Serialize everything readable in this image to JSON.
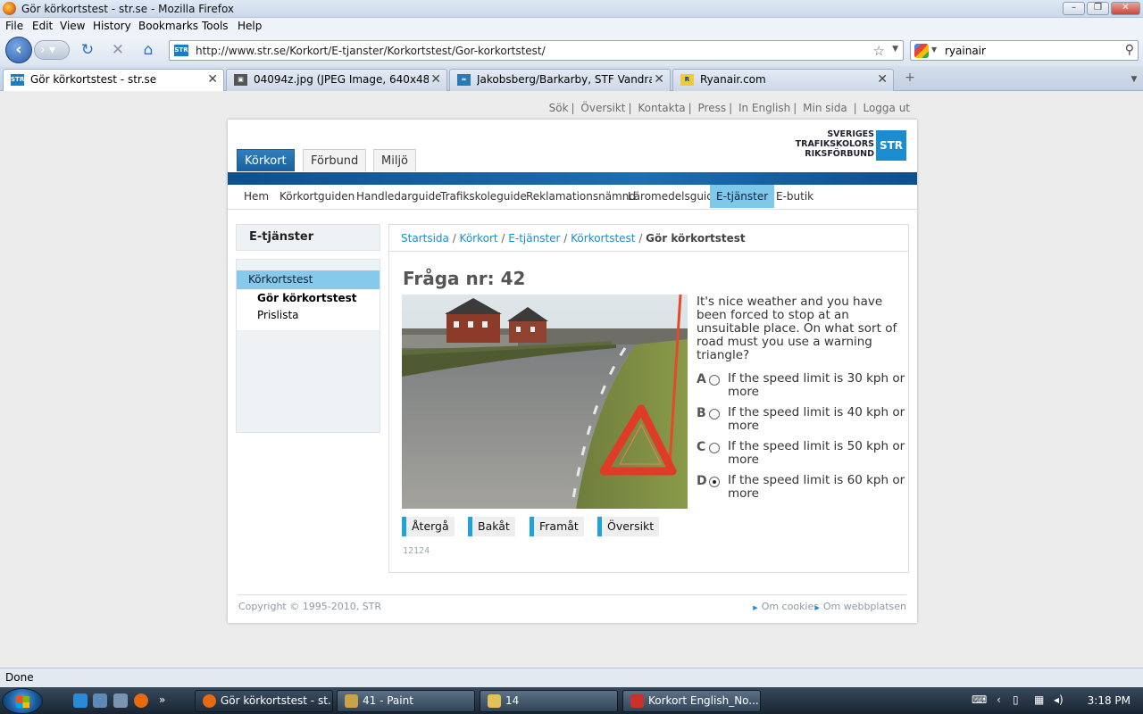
{
  "window": {
    "title": "Gör körkortstest - str.se - Mozilla Firefox"
  },
  "menu": [
    "File",
    "Edit",
    "View",
    "History",
    "Bookmarks",
    "Tools",
    "Help"
  ],
  "nav": {
    "url": "http://www.str.se/Korkort/E-tjanster/Korkortstest/Gor-korkortstest/",
    "search_value": "ryainair"
  },
  "tabs": [
    {
      "label": "Gör körkortstest - str.se",
      "active": true
    },
    {
      "label": "04094z.jpg (JPEG Image, 640x480 pix...",
      "active": false
    },
    {
      "label": "Jakobsberg/Barkarby, STF Vandrarh...",
      "active": false
    },
    {
      "label": "Ryanair.com",
      "active": false
    }
  ],
  "site": {
    "util_links": [
      "Sök",
      "Översikt",
      "Kontakta",
      "Press",
      "In English",
      "Min sida",
      "Logga ut"
    ],
    "main_tabs": [
      "Körkort",
      "Förbund",
      "Miljö"
    ],
    "logo": {
      "line1": "SVERIGES",
      "line2": "TRAFIKSKOLORS",
      "line3": "RIKSFÖRBUND",
      "mark": "STR"
    },
    "subnav": [
      "Hem",
      "Körkortguiden",
      "Handledarguide",
      "Trafikskoleguide",
      "Reklamationsnämnd",
      "Läromedelsguide",
      "E-tjänster",
      "E-butik"
    ],
    "sidebar": {
      "title": "E-tjänster",
      "section": "Körkortstest",
      "items": [
        "Gör körkortstest",
        "Prislista"
      ]
    },
    "breadcrumb": [
      "Startsida",
      "Körkort",
      "E-tjänster",
      "Körkortstest",
      "Gör körkortstest"
    ],
    "question": {
      "number_label": "Fråga nr: 42",
      "text": "It's nice weather and you have been forced to stop at an unsuitable place. On what sort of road must you use a warning triangle?",
      "options": [
        {
          "letter": "A",
          "text": "If the speed limit is 30 kph or more",
          "selected": false
        },
        {
          "letter": "B",
          "text": "If the speed limit is 40 kph or more",
          "selected": false
        },
        {
          "letter": "C",
          "text": "If the speed limit is 50 kph or more",
          "selected": false
        },
        {
          "letter": "D",
          "text": "If the speed limit is 60 kph or more",
          "selected": true
        }
      ],
      "buttons": [
        "Återgå",
        "Bakåt",
        "Framåt",
        "Översikt"
      ],
      "code": "12124"
    },
    "footer": {
      "copyright": "Copyright © 1995-2010, STR",
      "links": [
        "Om cookies",
        "Om webbplatsen"
      ]
    }
  },
  "status": "Done",
  "taskbar": {
    "tasks": [
      "Gör körkortstest - st...",
      "41 - Paint",
      "14",
      "Korkort English_No..."
    ],
    "clock": "3:18 PM"
  },
  "colors": {
    "accent": "#1b8dc8",
    "band": "#1d6eb0",
    "nav_active": "#7ec8ec"
  }
}
